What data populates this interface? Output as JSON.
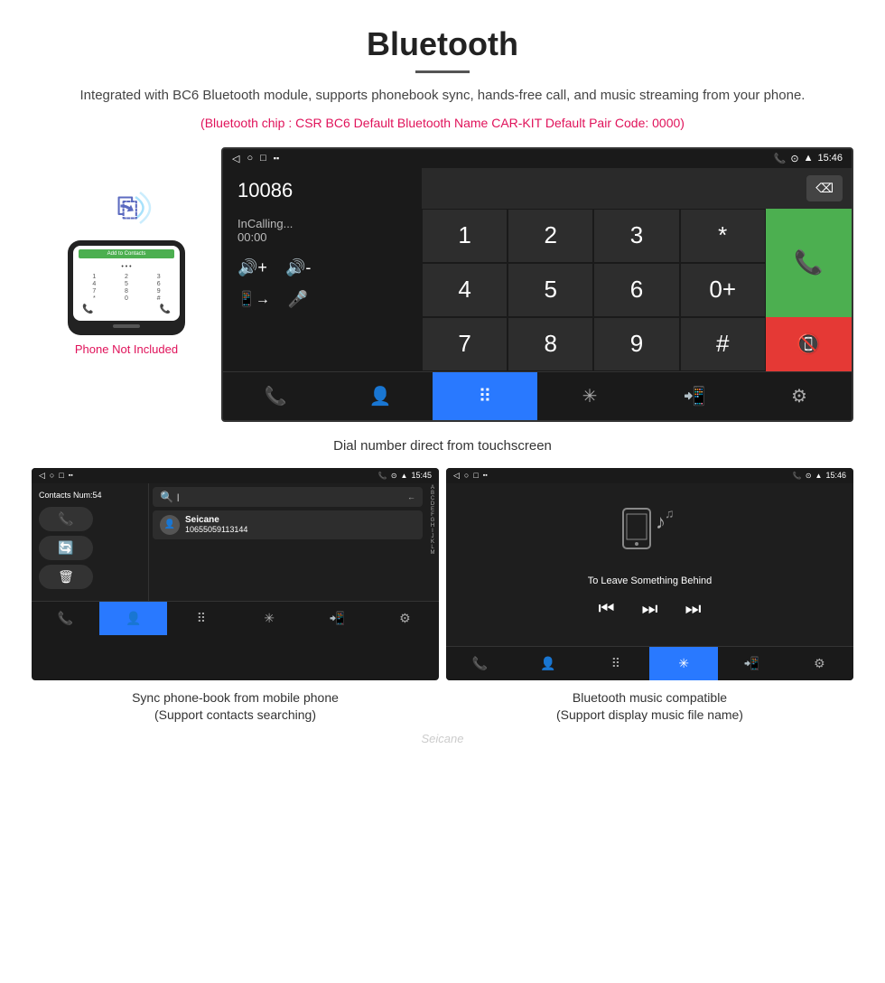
{
  "header": {
    "title": "Bluetooth",
    "description": "Integrated with BC6 Bluetooth module, supports phonebook sync, hands-free call, and music streaming from your phone.",
    "spec_line": "(Bluetooth chip : CSR BC6    Default Bluetooth Name CAR-KIT    Default Pair Code: 0000)"
  },
  "phone_side": {
    "not_included": "Phone Not Included",
    "add_contacts": "Add to Contacts"
  },
  "dial_screen": {
    "status_time": "15:46",
    "number": "10086",
    "calling_label": "InCalling...",
    "timer": "00:00",
    "keys": [
      "1",
      "2",
      "3",
      "*",
      "4",
      "5",
      "6",
      "0+",
      "7",
      "8",
      "9",
      "#"
    ],
    "input_value": ""
  },
  "main_caption": "Dial number direct from touchscreen",
  "contacts_screen": {
    "status_time": "15:45",
    "contacts_count": "Contacts Num:54",
    "contact_name": "Seicane",
    "contact_number": "10655059113144",
    "alpha_list": [
      "A",
      "B",
      "C",
      "D",
      "E",
      "F",
      "G",
      "H",
      "I",
      "J",
      "K",
      "L",
      "M"
    ]
  },
  "music_screen": {
    "status_time": "15:46",
    "song_title": "To Leave Something Behind"
  },
  "bottom_captions": {
    "left": "Sync phone-book from mobile phone\n(Support contacts searching)",
    "right": "Bluetooth music compatible\n(Support display music file name)"
  },
  "watermark": "Seicane"
}
